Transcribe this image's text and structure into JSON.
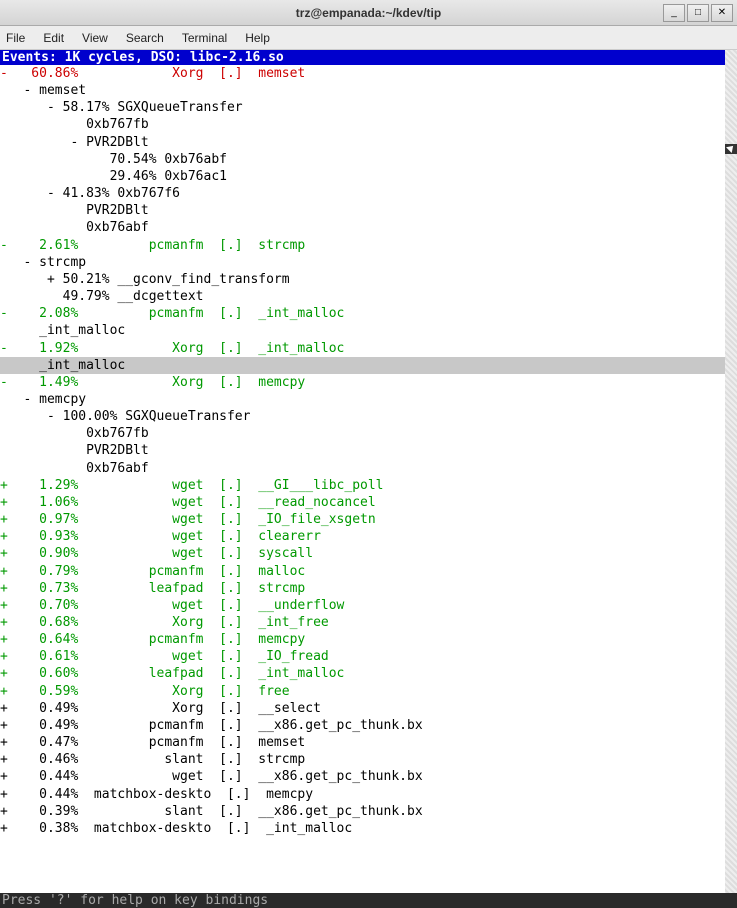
{
  "window": {
    "title": "trz@empanada:~/kdev/tip",
    "buttons": {
      "min": "_",
      "max": "□",
      "close": "✕"
    }
  },
  "menu": {
    "items": [
      "File",
      "Edit",
      "View",
      "Search",
      "Terminal",
      "Help"
    ]
  },
  "header": "Events: 1K cycles, DSO: libc-2.16.so",
  "footer": "Press '?' for help on key bindings",
  "rows": [
    {
      "c": "red",
      "t": "-   60.86%            Xorg  [.]  memset"
    },
    {
      "c": "black",
      "t": "   - memset"
    },
    {
      "c": "black",
      "t": "      - 58.17% SGXQueueTransfer"
    },
    {
      "c": "black",
      "t": "           0xb767fb"
    },
    {
      "c": "black",
      "t": "         - PVR2DBlt"
    },
    {
      "c": "black",
      "t": "              70.54% 0xb76abf"
    },
    {
      "c": "black",
      "t": "              29.46% 0xb76ac1"
    },
    {
      "c": "black",
      "t": "      - 41.83% 0xb767f6"
    },
    {
      "c": "black",
      "t": "           PVR2DBlt"
    },
    {
      "c": "black",
      "t": "           0xb76abf"
    },
    {
      "c": "green",
      "t": "-    2.61%         pcmanfm  [.]  strcmp"
    },
    {
      "c": "black",
      "t": "   - strcmp"
    },
    {
      "c": "black",
      "t": "      + 50.21% __gconv_find_transform"
    },
    {
      "c": "black",
      "t": "        49.79% __dcgettext"
    },
    {
      "c": "green",
      "t": "-    2.08%         pcmanfm  [.]  _int_malloc"
    },
    {
      "c": "black",
      "t": "     _int_malloc"
    },
    {
      "c": "green",
      "t": "-    1.92%            Xorg  [.]  _int_malloc"
    },
    {
      "c": "black",
      "t": "     _int_malloc",
      "sel": true
    },
    {
      "c": "green",
      "t": "-    1.49%            Xorg  [.]  memcpy"
    },
    {
      "c": "black",
      "t": "   - memcpy"
    },
    {
      "c": "black",
      "t": "      - 100.00% SGXQueueTransfer"
    },
    {
      "c": "black",
      "t": "           0xb767fb"
    },
    {
      "c": "black",
      "t": "           PVR2DBlt"
    },
    {
      "c": "black",
      "t": "           0xb76abf"
    },
    {
      "c": "green",
      "t": "+    1.29%            wget  [.]  __GI___libc_poll"
    },
    {
      "c": "green",
      "t": "+    1.06%            wget  [.]  __read_nocancel"
    },
    {
      "c": "green",
      "t": "+    0.97%            wget  [.]  _IO_file_xsgetn"
    },
    {
      "c": "green",
      "t": "+    0.93%            wget  [.]  clearerr"
    },
    {
      "c": "green",
      "t": "+    0.90%            wget  [.]  syscall"
    },
    {
      "c": "green",
      "t": "+    0.79%         pcmanfm  [.]  malloc"
    },
    {
      "c": "green",
      "t": "+    0.73%         leafpad  [.]  strcmp"
    },
    {
      "c": "green",
      "t": "+    0.70%            wget  [.]  __underflow"
    },
    {
      "c": "green",
      "t": "+    0.68%            Xorg  [.]  _int_free"
    },
    {
      "c": "green",
      "t": "+    0.64%         pcmanfm  [.]  memcpy"
    },
    {
      "c": "green",
      "t": "+    0.61%            wget  [.]  _IO_fread"
    },
    {
      "c": "green",
      "t": "+    0.60%         leafpad  [.]  _int_malloc"
    },
    {
      "c": "green",
      "t": "+    0.59%            Xorg  [.]  free"
    },
    {
      "c": "black",
      "t": "+    0.49%            Xorg  [.]  __select"
    },
    {
      "c": "black",
      "t": "+    0.49%         pcmanfm  [.]  __x86.get_pc_thunk.bx"
    },
    {
      "c": "black",
      "t": "+    0.47%         pcmanfm  [.]  memset"
    },
    {
      "c": "black",
      "t": "+    0.46%           slant  [.]  strcmp"
    },
    {
      "c": "black",
      "t": "+    0.44%            wget  [.]  __x86.get_pc_thunk.bx"
    },
    {
      "c": "black",
      "t": "+    0.44%  matchbox-deskto  [.]  memcpy"
    },
    {
      "c": "black",
      "t": "+    0.39%           slant  [.]  __x86.get_pc_thunk.bx"
    },
    {
      "c": "black",
      "t": "+    0.38%  matchbox-deskto  [.]  _int_malloc"
    }
  ]
}
